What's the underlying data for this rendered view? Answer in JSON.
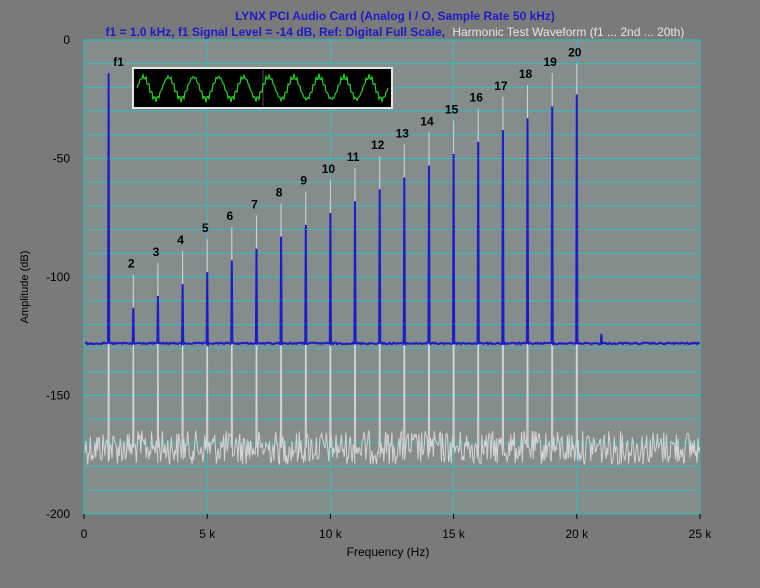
{
  "chart_data": {
    "type": "line",
    "title": "LYNX PCI Audio Card (Analog I / O, Sample Rate 50 kHz)",
    "subtitle_main": "f1 = 1.0 kHz, f1 Signal Level = -14 dB, Ref: Digital Full Scale,",
    "subtitle_waveform": "Harmonic Test Waveform (f1 ... 2nd ... 20th)",
    "xlabel": "Frequency (Hz)",
    "ylabel": "Amplitude (dB)",
    "xlim": [
      0,
      25000
    ],
    "ylim": [
      -200,
      0
    ],
    "x_ticks": [
      {
        "value": 0,
        "label": "0"
      },
      {
        "value": 5000,
        "label": "5 k"
      },
      {
        "value": 10000,
        "label": "10 k"
      },
      {
        "value": 15000,
        "label": "15 k"
      },
      {
        "value": 20000,
        "label": "20 k"
      },
      {
        "value": 25000,
        "label": "25 k"
      }
    ],
    "y_ticks": [
      {
        "value": 0,
        "label": "0"
      },
      {
        "value": -50,
        "label": "-50"
      },
      {
        "value": -100,
        "label": "-100"
      },
      {
        "value": -150,
        "label": "-150"
      },
      {
        "value": -200,
        "label": "-200"
      }
    ],
    "grid": true,
    "colors": {
      "background": "#7a7a7a",
      "plot_area": "#848c8c",
      "grid": "#29c4c4",
      "blue_trace": "#1c1cc8",
      "white_trace": "#d4d4d4",
      "title": "#1c1cc8",
      "inset_background": "#000000",
      "inset_trace": "#22d422"
    },
    "series": [
      {
        "name": "",
        "color": "#1c1cc8",
        "noise_floor_db": -128,
        "peaks": [
          {
            "x": 1000,
            "y": -14
          },
          {
            "x": 2000,
            "y": -113
          },
          {
            "x": 3000,
            "y": -108
          },
          {
            "x": 4000,
            "y": -103
          },
          {
            "x": 5000,
            "y": -98
          },
          {
            "x": 6000,
            "y": -93
          },
          {
            "x": 7000,
            "y": -88
          },
          {
            "x": 8000,
            "y": -83
          },
          {
            "x": 9000,
            "y": -78
          },
          {
            "x": 10000,
            "y": -73
          },
          {
            "x": 11000,
            "y": -68
          },
          {
            "x": 12000,
            "y": -63
          },
          {
            "x": 13000,
            "y": -58
          },
          {
            "x": 14000,
            "y": -53
          },
          {
            "x": 15000,
            "y": -48
          },
          {
            "x": 16000,
            "y": -43
          },
          {
            "x": 17000,
            "y": -38
          },
          {
            "x": 18000,
            "y": -33
          },
          {
            "x": 19000,
            "y": -28
          },
          {
            "x": 20000,
            "y": -23
          },
          {
            "x": 21000,
            "y": -124
          }
        ]
      },
      {
        "name": "",
        "color": "#d4d4d4",
        "noise_floor_db": -172,
        "peaks": [
          {
            "x": 1000,
            "y": -14
          },
          {
            "x": 2000,
            "y": -99
          },
          {
            "x": 3000,
            "y": -94
          },
          {
            "x": 4000,
            "y": -89
          },
          {
            "x": 5000,
            "y": -84
          },
          {
            "x": 6000,
            "y": -79
          },
          {
            "x": 7000,
            "y": -74
          },
          {
            "x": 8000,
            "y": -69
          },
          {
            "x": 9000,
            "y": -64
          },
          {
            "x": 10000,
            "y": -59
          },
          {
            "x": 11000,
            "y": -54
          },
          {
            "x": 12000,
            "y": -49
          },
          {
            "x": 13000,
            "y": -44
          },
          {
            "x": 14000,
            "y": -39
          },
          {
            "x": 15000,
            "y": -34
          },
          {
            "x": 16000,
            "y": -29
          },
          {
            "x": 17000,
            "y": -24
          },
          {
            "x": 18000,
            "y": -19
          },
          {
            "x": 19000,
            "y": -14
          },
          {
            "x": 20000,
            "y": -10
          }
        ]
      }
    ],
    "annotations": [
      {
        "text": "f1",
        "x": 1000
      },
      {
        "text": "2",
        "x": 2000
      },
      {
        "text": "3",
        "x": 3000
      },
      {
        "text": "4",
        "x": 4000
      },
      {
        "text": "5",
        "x": 5000
      },
      {
        "text": "6",
        "x": 6000
      },
      {
        "text": "7",
        "x": 7000
      },
      {
        "text": "8",
        "x": 8000
      },
      {
        "text": "9",
        "x": 9000
      },
      {
        "text": "10",
        "x": 10000
      },
      {
        "text": "11",
        "x": 11000
      },
      {
        "text": "12",
        "x": 12000
      },
      {
        "text": "13",
        "x": 13000
      },
      {
        "text": "14",
        "x": 14000
      },
      {
        "text": "15",
        "x": 15000
      },
      {
        "text": "16",
        "x": 16000
      },
      {
        "text": "17",
        "x": 17000
      },
      {
        "text": "18",
        "x": 18000
      },
      {
        "text": "19",
        "x": 19000
      },
      {
        "text": "20",
        "x": 20000
      }
    ]
  }
}
